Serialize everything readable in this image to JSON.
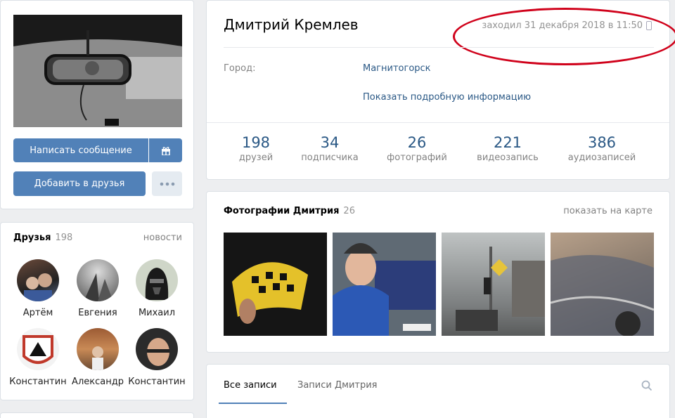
{
  "profile": {
    "name": "Дмитрий Кремлев",
    "last_seen": "заходил 31 декабря 2018 в 11:50",
    "info": {
      "city_label": "Город:",
      "city_value": "Магнитогорск",
      "more_link": "Показать подробную информацию"
    },
    "stats": [
      {
        "value": "198",
        "label": "друзей"
      },
      {
        "value": "34",
        "label": "подписчика"
      },
      {
        "value": "26",
        "label": "фотографий"
      },
      {
        "value": "221",
        "label": "видеозапись"
      },
      {
        "value": "386",
        "label": "аудиозаписей"
      }
    ]
  },
  "actions": {
    "message_label": "Написать сообщение",
    "add_friend_label": "Добавить в друзья",
    "gift_icon": "gift-icon",
    "more_icon": "more-dots-icon"
  },
  "friends": {
    "title": "Друзья",
    "count": "198",
    "news_link": "новости",
    "items": [
      {
        "name": "Артём"
      },
      {
        "name": "Евгения"
      },
      {
        "name": "Михаил"
      },
      {
        "name": "Константин"
      },
      {
        "name": "Александр"
      },
      {
        "name": "Константин"
      }
    ]
  },
  "photos": {
    "title": "Фотографии Дмитрия",
    "count": "26",
    "map_link": "показать на карте"
  },
  "wall": {
    "tabs": [
      {
        "label": "Все записи"
      },
      {
        "label": "Записи Дмитрия"
      }
    ],
    "search_icon": "search-icon"
  },
  "colors": {
    "accent": "#5181b8",
    "link": "#2a5885",
    "annotation_red": "#d0021b",
    "background": "#edeef0"
  }
}
